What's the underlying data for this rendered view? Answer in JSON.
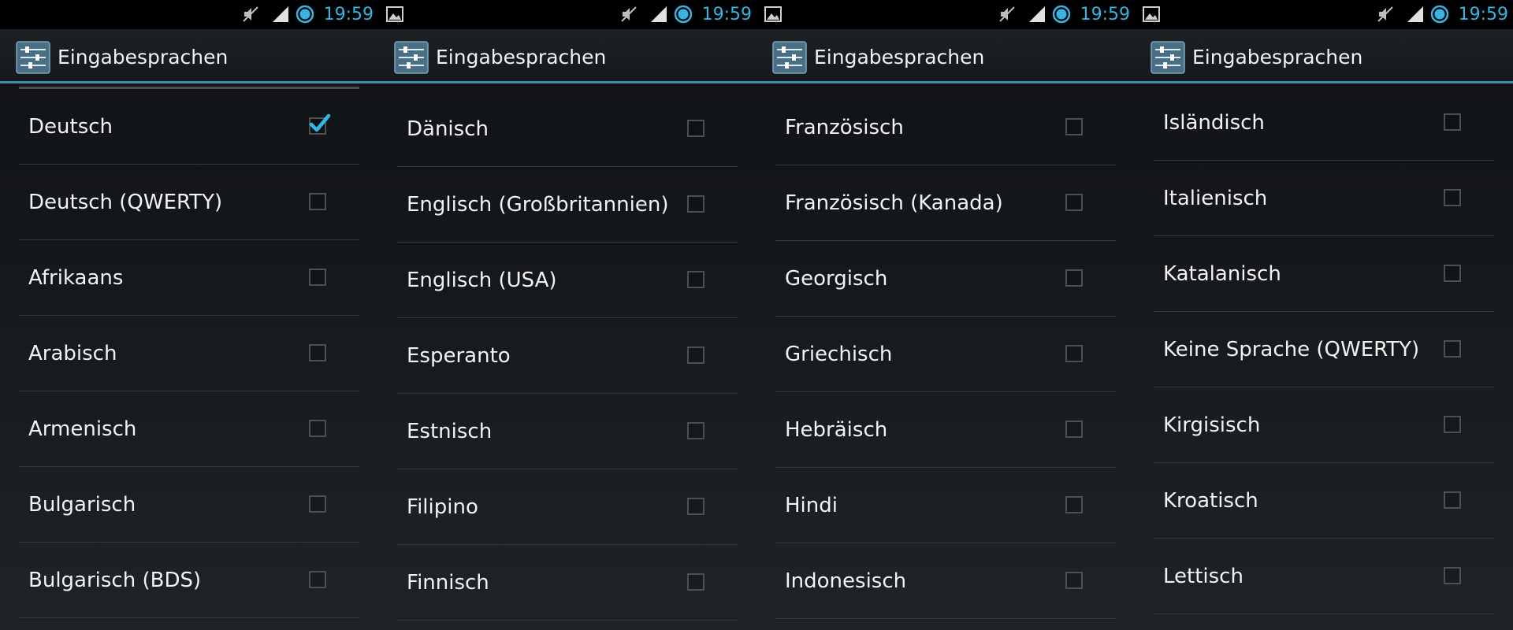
{
  "accent_color": "#33b5e5",
  "status_icons": [
    "image-notification-icon",
    "mute-icon",
    "signal-icon",
    "battery-icon"
  ],
  "screens": [
    {
      "clock": "19:59",
      "title": "Eingabesprachen",
      "items": [
        {
          "label": "Deutsch",
          "checked": true
        },
        {
          "label": "Deutsch (QWERTY)",
          "checked": false
        },
        {
          "label": "Afrikaans",
          "checked": false
        },
        {
          "label": "Arabisch",
          "checked": false
        },
        {
          "label": "Armenisch",
          "checked": false
        },
        {
          "label": "Bulgarisch",
          "checked": false
        },
        {
          "label": "Bulgarisch (BDS)",
          "checked": false
        }
      ]
    },
    {
      "clock": "19:59",
      "title": "Eingabesprachen",
      "items": [
        {
          "label": "Dänisch",
          "checked": false
        },
        {
          "label": "Englisch (Großbritannien)",
          "checked": false
        },
        {
          "label": "Englisch (USA)",
          "checked": false
        },
        {
          "label": "Esperanto",
          "checked": false
        },
        {
          "label": "Estnisch",
          "checked": false
        },
        {
          "label": "Filipino",
          "checked": false
        },
        {
          "label": "Finnisch",
          "checked": false
        }
      ]
    },
    {
      "clock": "19:59",
      "title": "Eingabesprachen",
      "items": [
        {
          "label": "Französisch",
          "checked": false
        },
        {
          "label": "Französisch (Kanada)",
          "checked": false
        },
        {
          "label": "Georgisch",
          "checked": false
        },
        {
          "label": "Griechisch",
          "checked": false
        },
        {
          "label": "Hebräisch",
          "checked": false
        },
        {
          "label": "Hindi",
          "checked": false
        },
        {
          "label": "Indonesisch",
          "checked": false
        }
      ]
    },
    {
      "clock": "19:59",
      "title": "Eingabesprachen",
      "items": [
        {
          "label": "Isländisch",
          "checked": false
        },
        {
          "label": "Italienisch",
          "checked": false
        },
        {
          "label": "Katalanisch",
          "checked": false
        },
        {
          "label": "Keine Sprache (QWERTY)",
          "checked": false
        },
        {
          "label": "Kirgisisch",
          "checked": false
        },
        {
          "label": "Kroatisch",
          "checked": false
        },
        {
          "label": "Lettisch",
          "checked": false
        }
      ]
    }
  ]
}
